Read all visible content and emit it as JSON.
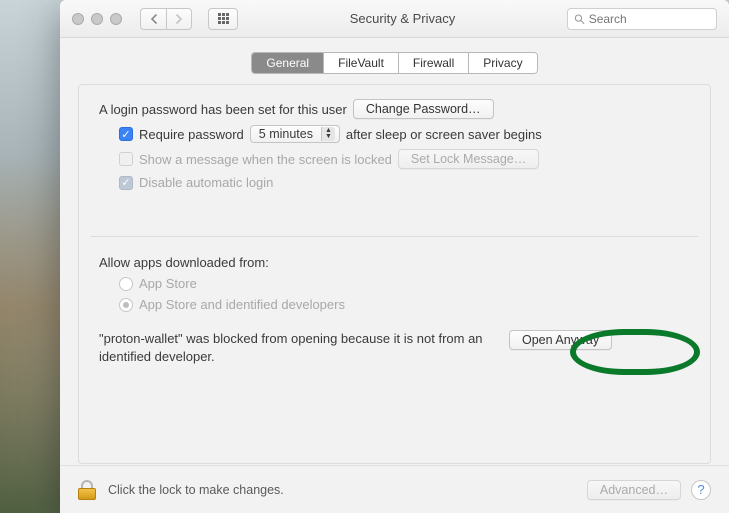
{
  "window": {
    "title": "Security & Privacy",
    "search_placeholder": "Search"
  },
  "tabs": [
    "General",
    "FileVault",
    "Firewall",
    "Privacy"
  ],
  "login": {
    "password_set_text": "A login password has been set for this user",
    "change_password_btn": "Change Password…",
    "require_password_label": "Require password",
    "require_password_value": "5 minutes",
    "after_sleep_text": "after sleep or screen saver begins",
    "show_message_label": "Show a message when the screen is locked",
    "set_lock_message_btn": "Set Lock Message…",
    "disable_auto_login_label": "Disable automatic login"
  },
  "download": {
    "allow_label": "Allow apps downloaded from:",
    "option_appstore": "App Store",
    "option_identified": "App Store and identified developers",
    "blocked_text": "\"proton-wallet\" was blocked from opening because it is not from an identified developer.",
    "open_anyway_btn": "Open Anyway"
  },
  "footer": {
    "lock_text": "Click the lock to make changes.",
    "advanced_btn": "Advanced…",
    "help": "?"
  }
}
